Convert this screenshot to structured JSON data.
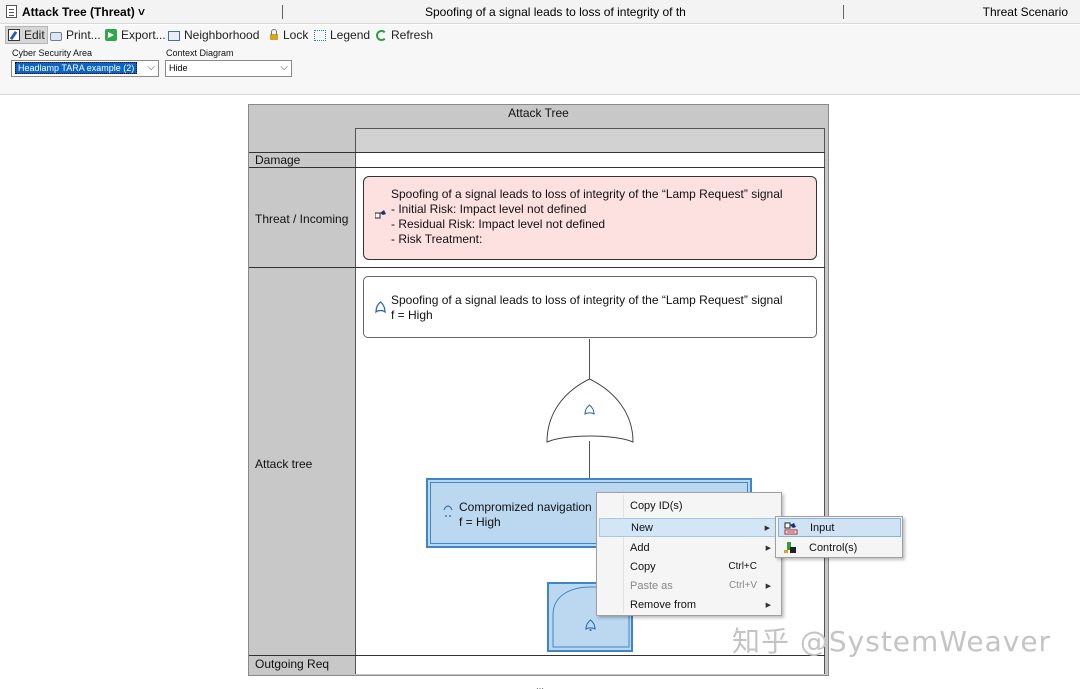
{
  "titlebar": {
    "title": "Attack Tree (Threat) ˅",
    "center_text": "Spoofing of a signal leads to loss of integrity of th",
    "right_text": "Threat Scenario"
  },
  "toolbar": {
    "edit": "Edit",
    "print": "Print...",
    "export": "Export...",
    "neighborhood": "Neighborhood",
    "lock": "Lock",
    "legend": "Legend",
    "refresh": "Refresh"
  },
  "filters": {
    "area_label": "Cyber Security Area",
    "area_value": "Headlamp TARA example (2)",
    "context_label": "Context Diagram",
    "context_value": "Hide"
  },
  "diagram": {
    "title": "Attack Tree",
    "lanes": {
      "damage": "Damage",
      "threat": "Threat / Incoming",
      "attack_tree": "Attack tree",
      "outgoing": "Outgoing Req"
    },
    "threat_box": {
      "line1": "Spoofing of a signal leads to loss of integrity of the “Lamp Request” signal",
      "line2": "- Initial Risk: Impact level not defined",
      "line3": "- Residual Risk: Impact level not defined",
      "line4": "- Risk Treatment:"
    },
    "goal_box": {
      "line1": "Spoofing of a signal leads to loss of integrity of the “Lamp Request” signal",
      "line2": "f = High"
    },
    "compromised_box": {
      "line1": "Compromized navigation",
      "line2": "f = High"
    }
  },
  "context_menu": {
    "items": [
      {
        "label": "Copy ID(s)",
        "shortcut": ""
      },
      {
        "label": "New",
        "shortcut": ""
      },
      {
        "label": "Add",
        "shortcut": ""
      },
      {
        "label": "Copy",
        "shortcut": "Ctrl+C"
      },
      {
        "label": "Paste as",
        "shortcut": "Ctrl+V"
      },
      {
        "label": "Remove from",
        "shortcut": ""
      }
    ],
    "submenu": [
      {
        "label": "Input"
      },
      {
        "label": "Control(s)"
      }
    ]
  },
  "watermark": "知乎 @SystemWeaver",
  "colors": {
    "threat_fill": "#fde1e1",
    "selected_fill": "#bcd8f1",
    "selected_border": "#3f86c6",
    "lane_gray": "#c8c8c8"
  },
  "icons": {
    "threat": "threat-scenario-icon",
    "goal": "or-gate-icon",
    "gate": "or-gate-icon",
    "new_input": "input-icon",
    "control": "control-icon"
  }
}
